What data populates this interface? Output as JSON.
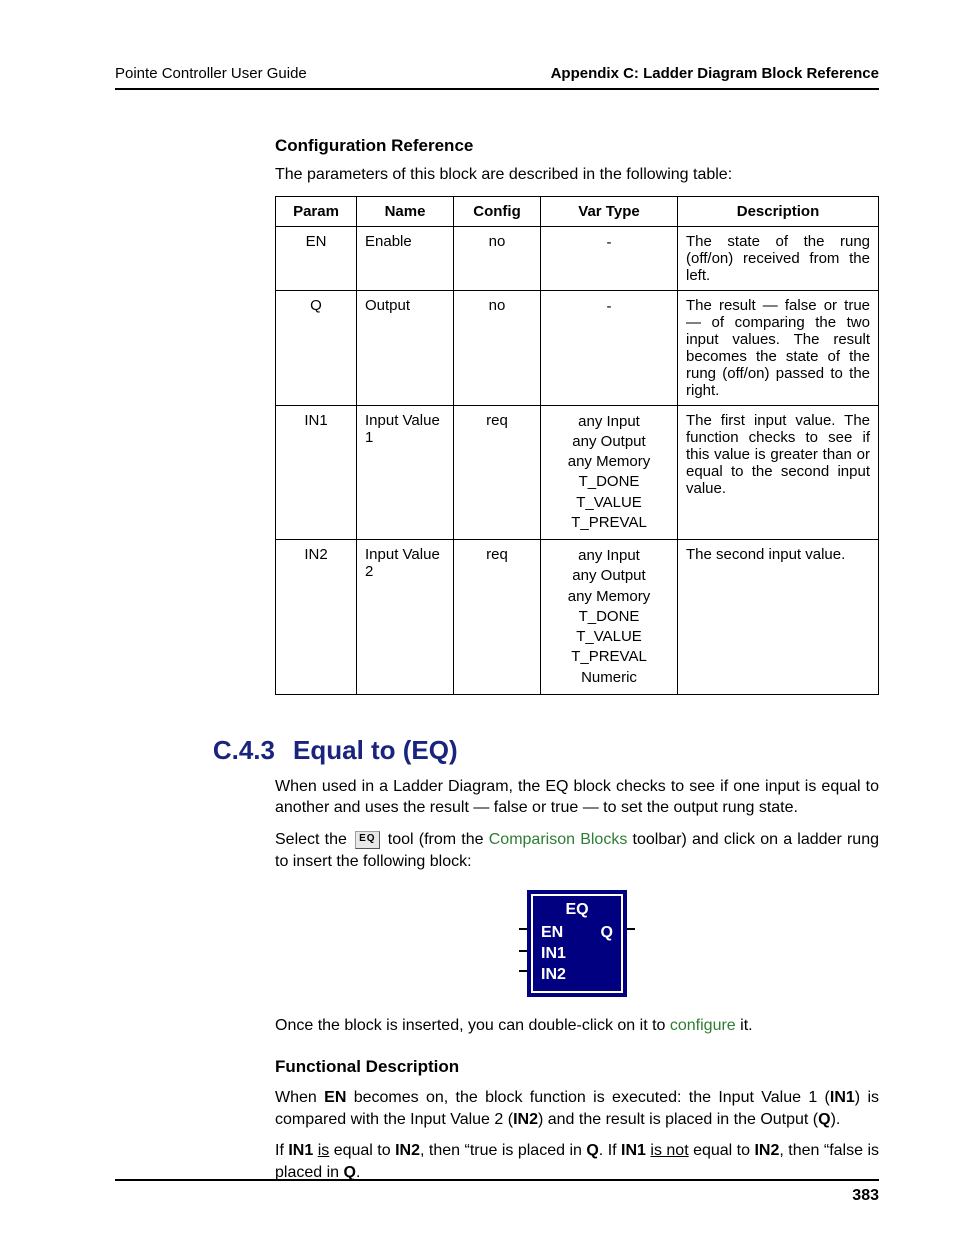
{
  "header": {
    "left": "Pointe Controller User Guide",
    "right": "Appendix C: Ladder Diagram Block Reference"
  },
  "config_ref": {
    "heading": "Configuration Reference",
    "intro": "The parameters of this block are described in the following table:",
    "columns": {
      "c0": "Param",
      "c1": "Name",
      "c2": "Config",
      "c3": "Var Type",
      "c4": "Description"
    },
    "rows": [
      {
        "param": "EN",
        "name": "Enable",
        "config": "no",
        "vartype": "-",
        "desc": "The state of the rung (off/on) received from the left."
      },
      {
        "param": "Q",
        "name": "Output",
        "config": "no",
        "vartype": "-",
        "desc": "The result — false or true — of comparing the two input values. The result becomes the state of the rung (off/on) passed to the right."
      },
      {
        "param": "IN1",
        "name": "Input Value 1",
        "config": "req",
        "vartype": "any Input\nany Output\nany Memory\nT_DONE\nT_VALUE\nT_PREVAL",
        "desc": "The first input value. The function checks to see if this value is greater than or equal to the second input value."
      },
      {
        "param": "IN2",
        "name": "Input Value 2",
        "config": "req",
        "vartype": "any Input\nany Output\nany Memory\nT_DONE\nT_VALUE\nT_PREVAL\nNumeric",
        "desc": "The second input value."
      }
    ]
  },
  "section": {
    "number": "C.4.3",
    "title": "Equal to (EQ)",
    "p1": "When used in a Ladder Diagram, the EQ block checks to see if one input is equal to another and uses the result — false or true — to set the output rung state.",
    "select_pre": "Select the ",
    "icon_label": "EQ",
    "select_mid": " tool (from the ",
    "toolbar_link": "Comparison Blocks",
    "select_post": " toolbar) and click on a ladder rung to insert the following block:",
    "block": {
      "title": "EQ",
      "en": "EN",
      "q": "Q",
      "in1": "IN1",
      "in2": "IN2"
    },
    "p_after_block_pre": "Once the block is inserted, you can double-click on it to ",
    "configure_link": "configure",
    "p_after_block_post": " it.",
    "func_heading": "Functional Description",
    "fd": {
      "when": "When ",
      "en": "EN",
      "a": " becomes on, the block function is executed: the Input Value 1  (",
      "in1": "IN1",
      "b": ") is compared with the Input Value 2 (",
      "in2": "IN2",
      "c": ") and the result is placed in the Output (",
      "q": "Q",
      "d": ")."
    },
    "fd2": {
      "if": "If ",
      "in1": "IN1",
      "sp": " ",
      "is": "is",
      "eq": " equal to ",
      "in2": "IN2",
      "then": ", then “true is placed in ",
      "q": "Q",
      "dot_if": ". If ",
      "isnot": "is not",
      "then2": ", then “false is placed in ",
      "dot": "."
    }
  },
  "footer": {
    "page": "383"
  }
}
